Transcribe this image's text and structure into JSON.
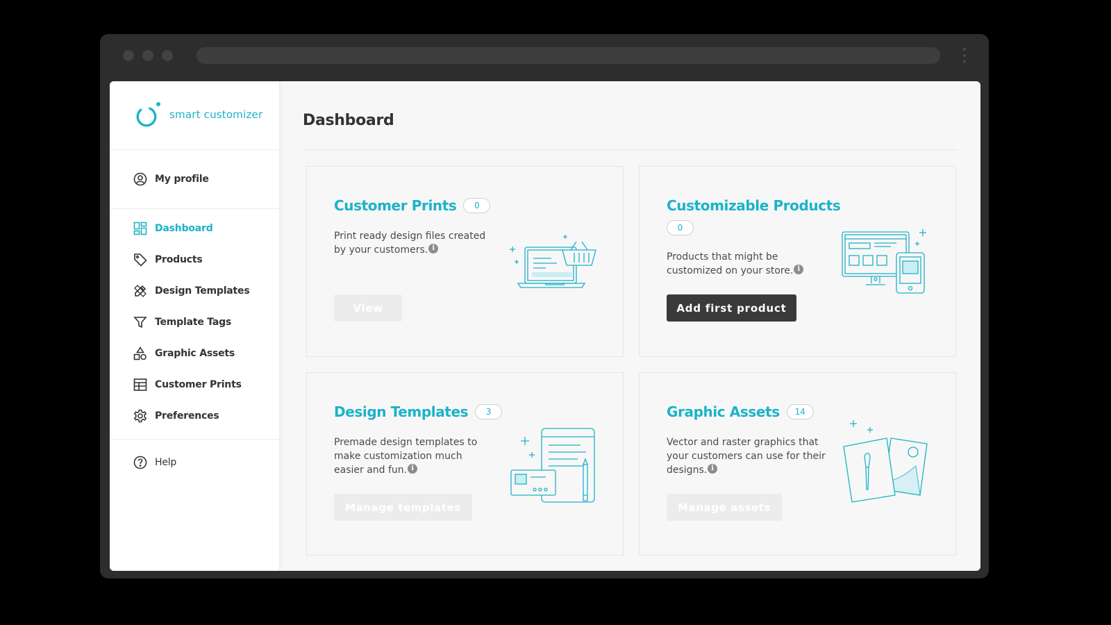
{
  "app": {
    "brand": "smart customizer",
    "accent_color": "#1bb3c8"
  },
  "sidebar": {
    "profile": {
      "label": "My profile",
      "icon": "user-circle-icon"
    },
    "items": [
      {
        "label": "Dashboard",
        "icon": "dashboard-grid-icon",
        "active": true
      },
      {
        "label": "Products",
        "icon": "tag-icon"
      },
      {
        "label": "Design Templates",
        "icon": "pencil-ruler-icon"
      },
      {
        "label": "Template Tags",
        "icon": "filter-icon"
      },
      {
        "label": "Graphic Assets",
        "icon": "shapes-icon"
      },
      {
        "label": "Customer Prints",
        "icon": "prints-icon"
      },
      {
        "label": "Preferences",
        "icon": "gear-icon"
      }
    ],
    "help": {
      "label": "Help",
      "icon": "question-circle-icon"
    }
  },
  "main": {
    "title": "Dashboard",
    "cards": {
      "customer_prints": {
        "title": "Customer Prints",
        "count": "0",
        "description": "Print ready design files created by your customers.",
        "button": "View",
        "button_state": "disabled",
        "illustration": "laptop-basket-icon"
      },
      "customizable_products": {
        "title": "Customizable Products",
        "count": "0",
        "description": "Products that might be customized on your store.",
        "button": "Add first product",
        "button_state": "enabled",
        "illustration": "monitor-tablet-icon"
      },
      "design_templates": {
        "title": "Design Templates",
        "count": "3",
        "description": "Premade design templates to make customization much easier and fun.",
        "button": "Manage templates",
        "button_state": "disabled",
        "illustration": "documents-pencil-icon"
      },
      "graphic_assets": {
        "title": "Graphic Assets",
        "count": "14",
        "description": "Vector and raster graphics that your customers can use for their designs.",
        "button": "Manage assets",
        "button_state": "disabled",
        "illustration": "artwork-brush-icon"
      }
    },
    "info_glyph": "i"
  }
}
